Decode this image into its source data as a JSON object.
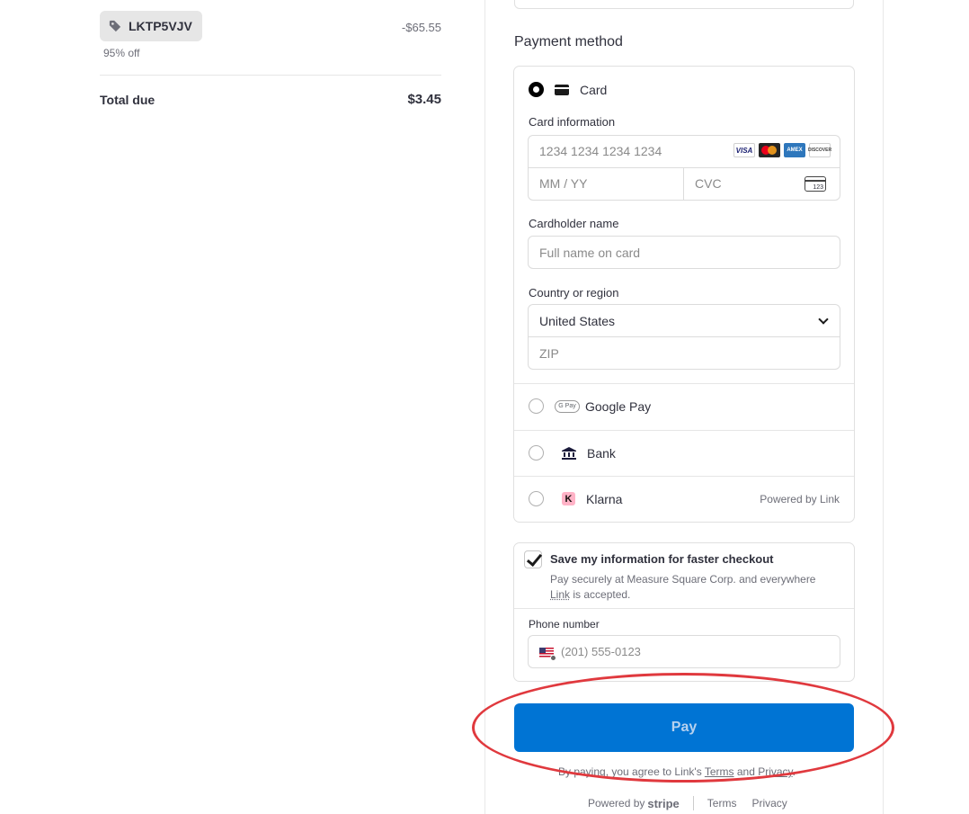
{
  "summary": {
    "promo_code": "LKTP5VJV",
    "promo_note": "95% off",
    "discount": "-$65.55",
    "total_label": "Total due",
    "total_value": "$3.45"
  },
  "payment": {
    "title": "Payment method",
    "card": {
      "label": "Card",
      "info_label": "Card information",
      "number_placeholder": "1234 1234 1234 1234",
      "expiry_placeholder": "MM / YY",
      "cvc_placeholder": "CVC",
      "cvc_icon_text": "123",
      "brands": [
        "VISA",
        "Mastercard",
        "AMEX",
        "DISCOVER"
      ],
      "holder_label": "Cardholder name",
      "holder_placeholder": "Full name on card",
      "country_label": "Country or region",
      "country_value": "United States",
      "zip_placeholder": "ZIP"
    },
    "options": {
      "google_pay": "Google Pay",
      "google_pay_icon": "G Pay",
      "bank": "Bank",
      "klarna": "Klarna",
      "klarna_icon": "K",
      "powered_by_link": "Powered by Link"
    }
  },
  "save": {
    "title": "Save my information for faster checkout",
    "desc_prefix": "Pay securely at Measure Square Corp. and everywhere ",
    "desc_link": "Link",
    "desc_suffix": " is accepted.",
    "phone_label": "Phone number",
    "phone_placeholder": "(201) 555-0123"
  },
  "pay": {
    "button_label": "Pay",
    "note_prefix": "By paying, you agree to Link's ",
    "note_terms": "Terms",
    "note_and": " and ",
    "note_privacy": "Privacy",
    "note_end": "."
  },
  "footer": {
    "powered_by": "Powered by",
    "brand": "stripe",
    "terms": "Terms",
    "privacy": "Privacy"
  },
  "colors": {
    "accent": "#0074d4",
    "highlight": "#e0393e"
  }
}
